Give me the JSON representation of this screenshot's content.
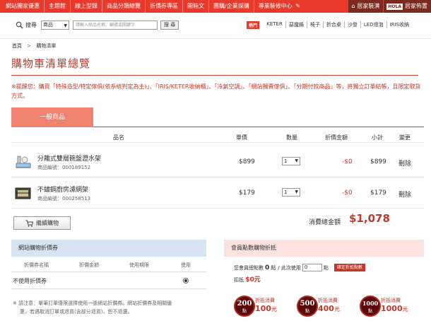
{
  "topnav": {
    "items": [
      "網站獨家優惠",
      "主題館",
      "線上型錄",
      "商品分類總覽",
      "折價券專區",
      "開箱文",
      "團購/企業採購",
      "專業裝修中心"
    ],
    "right_buttons": [
      {
        "label": "居家裝潢"
      },
      {
        "logo": "HOLA",
        "label": "居家佈置"
      }
    ]
  },
  "search": {
    "label": "搜尋",
    "select_value": "商品",
    "placeholder": "請輸入商品名稱、編號或關鍵字",
    "button": "搜 尋",
    "hot_label": "熱門",
    "keywords": [
      "KETER",
      "惡魔鍋",
      "椅子",
      "折合桌",
      "沙發",
      "LED燈泡",
      "IRIS收納"
    ]
  },
  "breadcrumb": {
    "home": "首頁",
    "sep": ">",
    "current": "購物清單"
  },
  "page_title": "購物車清單總覽",
  "notice": "※提醒您：購買「特殊造型/特定傢俱(依系統判定為主)」、「IRIS/KETER收納櫃」、「冷氣空調」、「網站獨賣傢俱」、「分期付款商品」等，將獨立訂單結帳，且限定取貨方式。",
  "tab": "一般商品",
  "table": {
    "headers": {
      "name": "品名",
      "price": "單價",
      "qty": "數量",
      "discount": "折價金額",
      "subtotal": "小計",
      "change": "變更"
    },
    "rows": [
      {
        "name": "分離式雙層碗盤瀝水架",
        "id": "商品編號：000189152",
        "price": "$899",
        "qty": "1",
        "discount": "-$0",
        "subtotal": "$899",
        "delete": "刪除"
      },
      {
        "name": "不鏽鋼廚房濾網架",
        "id": "商品編號：000258513",
        "price": "$179",
        "qty": "1",
        "discount": "-$0",
        "subtotal": "$179",
        "delete": "刪除"
      }
    ]
  },
  "continue_button": "繼續購物",
  "total": {
    "label": "消費總金額",
    "value": "$1,078"
  },
  "coupon": {
    "title": "網站購物折價券",
    "columns": [
      "折價券名稱",
      "折價金額",
      "使用期限",
      "使用"
    ],
    "no_use": "不使用折價券",
    "note_lines": [
      "※ 請注意：單筆訂單僅限選擇使用一張網站折價券。網站折價券及相關優",
      "惠，若遇取消訂單或退貨(含部分退貨)，恕不退還。"
    ]
  },
  "points": {
    "title": "會員點數購物折抵",
    "member_points_label": "您會員總點數",
    "member_points_value": "0",
    "unit": "點",
    "use_label": "/ 此次使用",
    "use_value": "0",
    "use_unit": "點",
    "confirm_button": "確定折抵點數",
    "deduct_label": "扣抵",
    "deduct_value": "$0元",
    "badges": [
      {
        "points": "200",
        "unit": "點",
        "label": "折抵消費",
        "amount": "100",
        "currency": "元"
      },
      {
        "points": "500",
        "unit": "點",
        "label": "折抵消費",
        "amount": "400",
        "currency": "元"
      },
      {
        "points": "1000",
        "unit": "點",
        "label": "折抵消費",
        "amount": "1000",
        "currency": "元"
      }
    ]
  },
  "colors": {
    "brand_red": "#e8392b",
    "price_red": "#c0392b",
    "tab_orange": "#f0836f",
    "coupon_header": "#d6e4f2",
    "points_header": "#fbe2df"
  }
}
